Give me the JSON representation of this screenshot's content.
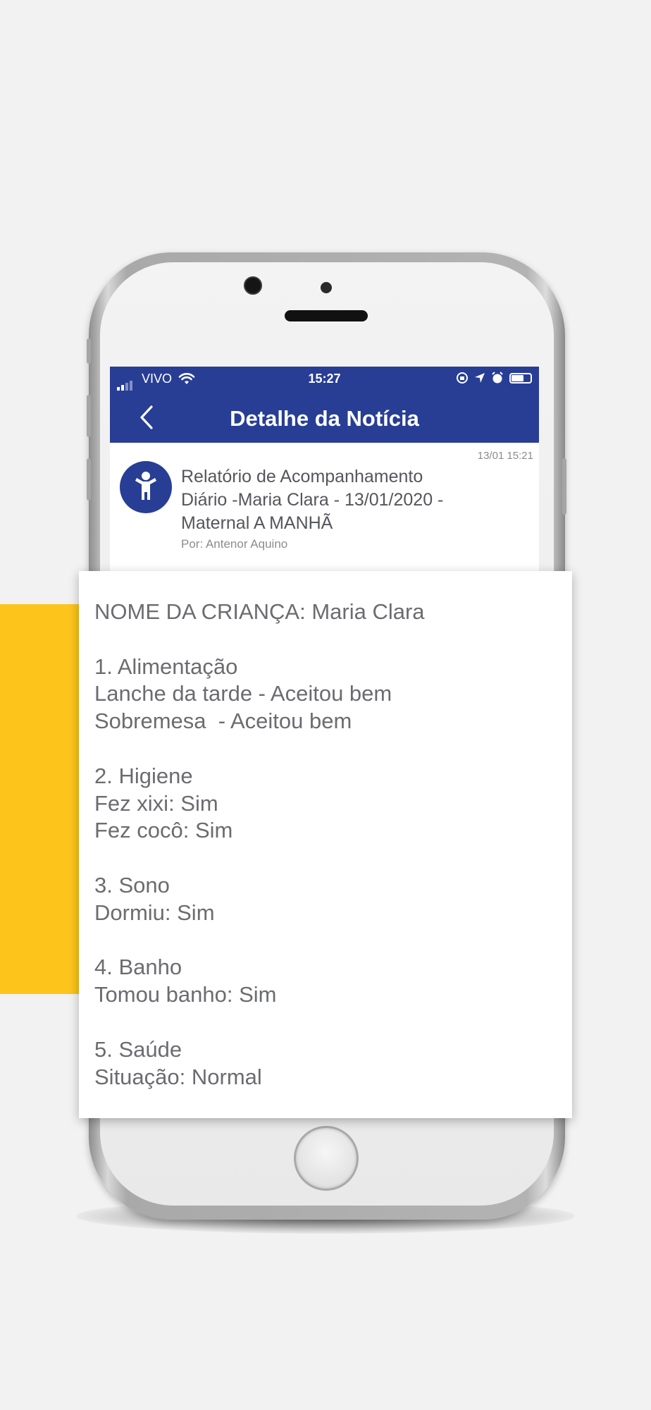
{
  "status_bar": {
    "carrier": "VIVO",
    "time": "15:27"
  },
  "nav": {
    "title": "Detalhe da Notícia",
    "back_icon": "chevron-left-icon"
  },
  "news": {
    "timestamp": "13/01 15:21",
    "title_lines": [
      "Relatório de Acompanhamento",
      "Diário -Maria Clara - 13/01/2020 -",
      "Maternal A MANHÃ"
    ],
    "author": "Por: Antenor Aquino",
    "avatar_icon": "child-icon"
  },
  "report": {
    "child_name": "NOME DA CRIANÇA: Maria Clara",
    "sections": [
      {
        "heading": "1. Alimentação",
        "items": [
          "Lanche da tarde - Aceitou bem",
          "Sobremesa  - Aceitou bem"
        ]
      },
      {
        "heading": "2. Higiene",
        "items": [
          "Fez xixi: Sim",
          "Fez cocô: Sim"
        ]
      },
      {
        "heading": "3. Sono",
        "items": [
          "Dormiu: Sim"
        ]
      },
      {
        "heading": "4. Banho",
        "items": [
          "Tomou banho: Sim"
        ]
      },
      {
        "heading": "5. Saúde",
        "items": [
          "Situação: Normal"
        ]
      }
    ]
  },
  "colors": {
    "brand_blue": "#283e95",
    "accent_yellow": "#fdc51b",
    "background": "#f2f2f2"
  }
}
